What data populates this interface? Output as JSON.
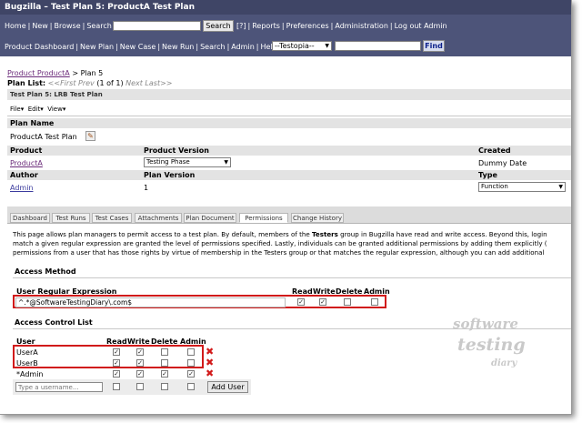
{
  "window": {
    "title": "Bugzilla – Test Plan 5: ProductA Test Plan"
  },
  "nav1": {
    "home": "Home",
    "new": "New",
    "browse": "Browse",
    "search": "Search",
    "search_button": "Search",
    "help_q": "[?]",
    "reports": "Reports",
    "preferences": "Preferences",
    "administration": "Administration",
    "logout": "Log out",
    "user": "Admin"
  },
  "nav2": {
    "dashboard": "Product Dashboard",
    "new_plan": "New Plan",
    "new_case": "New Case",
    "new_run": "New Run",
    "search": "Search",
    "admin": "Admin",
    "help": "Help",
    "testopia_select": "--Testopia--",
    "find_button": "Find"
  },
  "breadcrumb": {
    "product": "Product ProductA",
    "arrow": ">",
    "plan": "Plan 5"
  },
  "plan_list": {
    "label": "Plan List:",
    "first_prev": "<<First Prev",
    "count": "(1 of 1)",
    "next_last": "Next Last>>"
  },
  "section_header": "Test Plan 5: LRB Test Plan",
  "menus": {
    "file": "File",
    "edit": "Edit",
    "view": "View"
  },
  "plan": {
    "name_label": "Plan Name",
    "name_value": "ProductA Test Plan",
    "product_label": "Product",
    "product_value": "ProductA",
    "product_version_label": "Product Version",
    "product_version_value": "Testing Phase",
    "created_label": "Created",
    "created_value": "Dummy Date",
    "author_label": "Author",
    "author_value": "Admin",
    "plan_version_label": "Plan Version",
    "plan_version_value": "1",
    "type_label": "Type",
    "type_value": "Function"
  },
  "tabs": [
    "Dashboard",
    "Test Runs",
    "Test Cases",
    "Attachments",
    "Plan Document",
    "Permissions",
    "Change History"
  ],
  "description": {
    "line1_a": "This page allows plan managers to permit access to a test plan. By default, members of the ",
    "line1_b": "Testers",
    "line1_c": " group in Bugzilla have read and write access. Beyond this, login",
    "line2": "match a given regular expression are granted the level of permissions specified. Lastly, individuals can be granted additional permissions by adding them explicitly (",
    "line3": "permissions from a user that has those rights by virtue of membership in the Testers group or that matches the regular expression, although you can add additional"
  },
  "access_method": {
    "title": "Access Method",
    "col_user_regex": "User Regular Expression",
    "col_read": "Read",
    "col_write": "Write",
    "col_delete": "Delete",
    "col_admin": "Admin",
    "regex_value": "^.*@SoftwareTestingDiary\\.com$"
  },
  "acl": {
    "title": "Access Control List",
    "col_user": "User",
    "col_read": "Read",
    "col_write": "Write",
    "col_delete": "Delete",
    "col_admin": "Admin",
    "rows": [
      {
        "user": "UserA"
      },
      {
        "user": "UserB"
      },
      {
        "user": "*Admin"
      }
    ],
    "username_placeholder": "Type a username...",
    "add_user_button": "Add User"
  },
  "watermark": {
    "line1": "software",
    "line2": "testing",
    "line3": "diary"
  },
  "colors": {
    "nav_bg": "#4d5479",
    "title_bg": "#3f4566",
    "highlight": "#d11a1a",
    "band": "#e3e3e3"
  }
}
